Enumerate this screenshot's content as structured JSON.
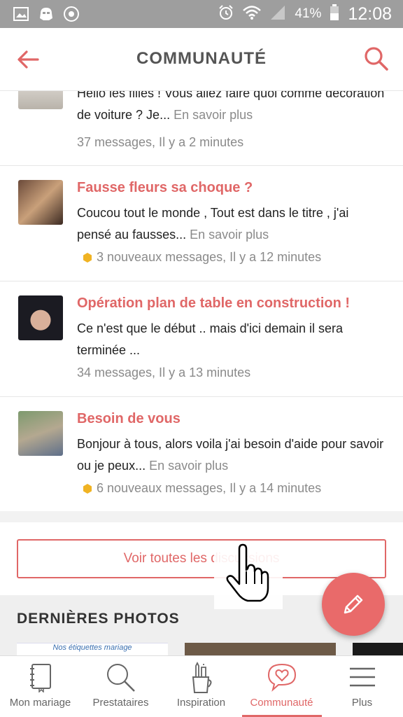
{
  "status_bar": {
    "battery": "41%",
    "time": "12:08",
    "icons": [
      "gallery-icon",
      "stormtrooper-icon",
      "settings-icon",
      "alarm-icon",
      "wifi-icon",
      "signal-icon",
      "battery-icon"
    ]
  },
  "header": {
    "title": "COMMUNAUTÉ",
    "back_icon": "arrow-left-icon",
    "search_icon": "search-icon"
  },
  "topics": [
    {
      "title": "",
      "body": "Hello les filles ! Vous allez faire quoi comme décoration de voiture ? Je...",
      "more": "En savoir plus",
      "meta": "37 messages, Il y a 2 minutes",
      "new": false
    },
    {
      "title": "Fausse fleurs sa choque ?",
      "body": "Coucou tout le monde , Tout est dans le titre , j'ai pensé au fausses...",
      "more": "En savoir plus",
      "meta": "3 nouveaux messages, Il y a 12 minutes",
      "new": true
    },
    {
      "title": "Opération plan de table en construction !",
      "body": "Ce n'est que le début .. mais d'ici demain il sera terminée ...",
      "more": "",
      "meta": "34 messages, Il y a 13 minutes",
      "new": false
    },
    {
      "title": "Besoin de vous",
      "body": "Bonjour à tous, alors voila j'ai besoin d'aide pour savoir ou je peux...",
      "more": "En savoir plus",
      "meta": "6 nouveaux messages, Il y a 14 minutes",
      "new": true
    }
  ],
  "see_all": {
    "label": "Voir toutes les discussions"
  },
  "photos": {
    "title": "DERNIÈRES PHOTOS",
    "items": [
      {
        "caption": "Nos étiquettes mariage"
      }
    ]
  },
  "fab": {
    "icon": "pencil-icon"
  },
  "bottom_nav": {
    "items": [
      {
        "label": "Mon mariage",
        "icon": "notebook-icon"
      },
      {
        "label": "Prestataires",
        "icon": "search-icon"
      },
      {
        "label": "Inspiration",
        "icon": "pencil-cup-icon"
      },
      {
        "label": "Communauté",
        "icon": "heart-bubble-icon"
      },
      {
        "label": "Plus",
        "icon": "menu-icon"
      }
    ],
    "active": "Communauté"
  },
  "colors": {
    "accent": "#e06767",
    "status_bar": "#9e9e9e",
    "badge": "#f0b323"
  }
}
